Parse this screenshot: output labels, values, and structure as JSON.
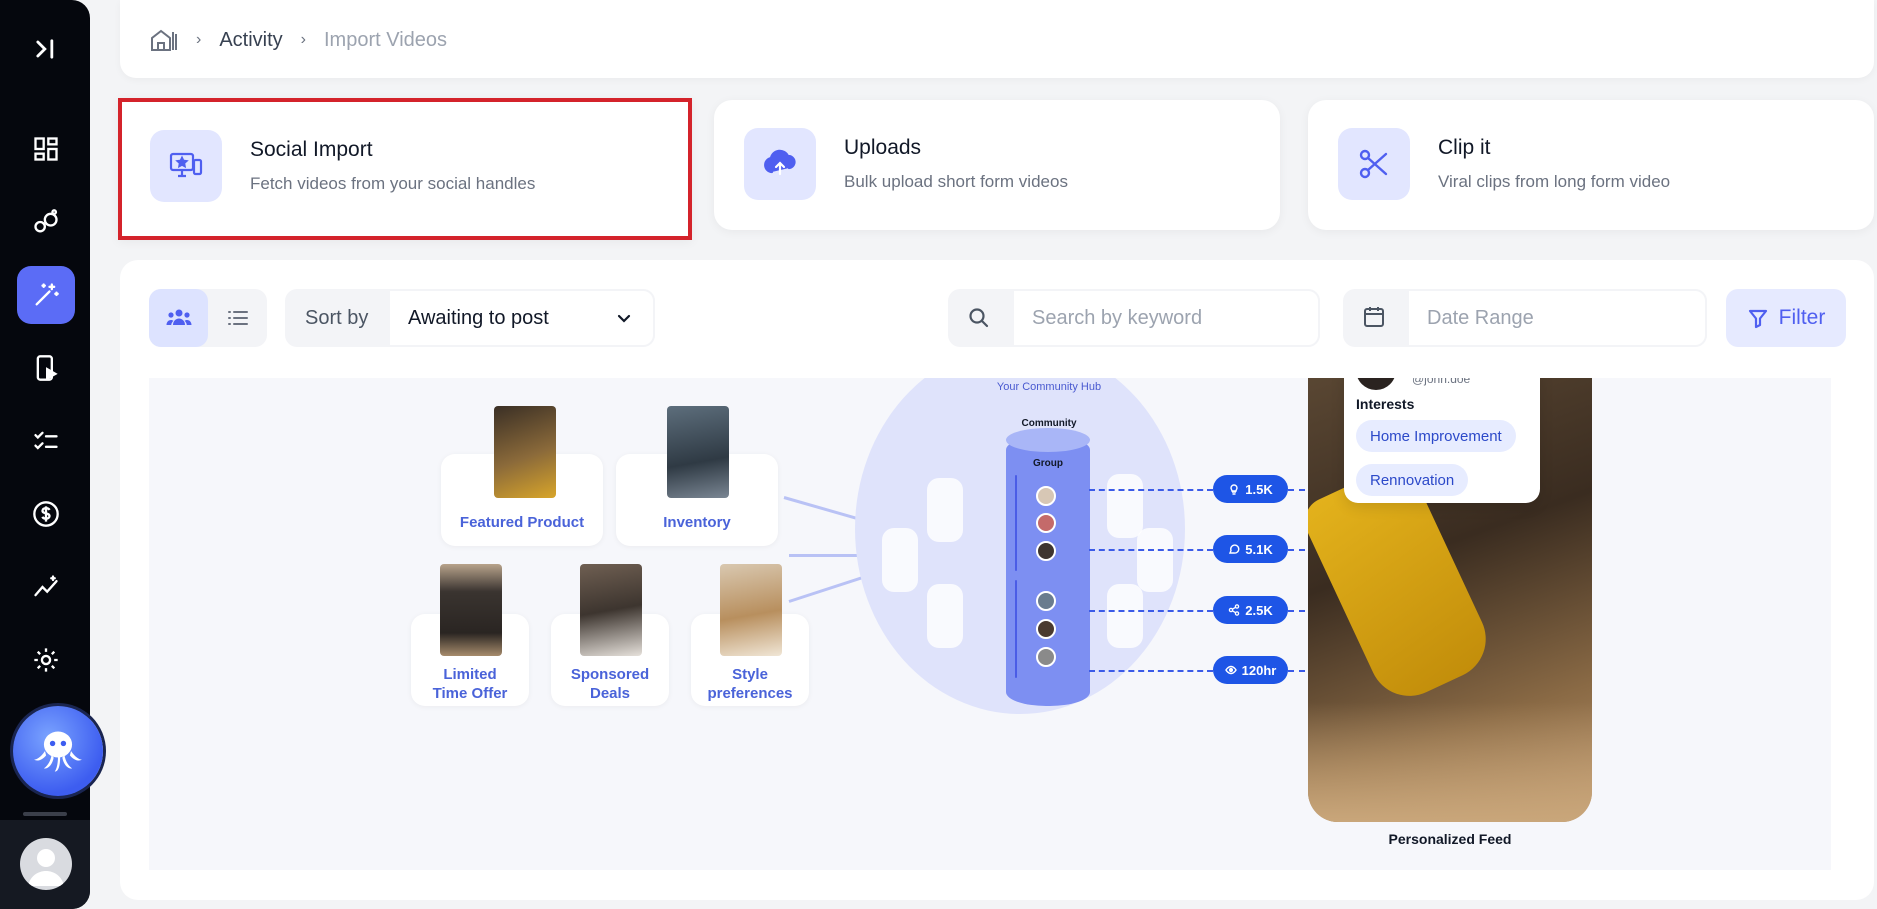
{
  "breadcrumb": {
    "items": [
      "Activity",
      "Import Videos"
    ]
  },
  "cards": [
    {
      "title": "Social Import",
      "subtitle": "Fetch videos from your social handles",
      "icon": "monitor-star-icon",
      "selected": true
    },
    {
      "title": "Uploads",
      "subtitle": "Bulk upload short form videos",
      "icon": "cloud-upload-icon",
      "selected": false
    },
    {
      "title": "Clip it",
      "subtitle": "Viral clips from long form video",
      "icon": "scissors-icon",
      "selected": false
    }
  ],
  "toolbar": {
    "sort_label": "Sort by",
    "sort_value": "Awaiting to post",
    "search_placeholder": "Search by keyword",
    "date_placeholder": "Date Range",
    "filter_label": "Filter"
  },
  "illustration": {
    "tiles": [
      "Featured Product",
      "Inventory",
      "Limited Time Offer",
      "Sponsored Deals",
      "Style preferences"
    ],
    "hub_title": "Your Community Hub",
    "community_label": "Community",
    "group_label": "Group",
    "metrics": [
      "1.5K",
      "5.1K",
      "2.5K",
      "120hr"
    ],
    "profile_handle": "@john.doe",
    "interests_label": "Interests",
    "interests": [
      "Home Improvement",
      "Rennovation"
    ],
    "feed_caption": "Personalized Feed"
  },
  "colors": {
    "accent": "#5b6cf6",
    "selected_border": "#d4232b",
    "sidebar_bg": "#05070d",
    "metric_blue": "#1e55e6"
  }
}
